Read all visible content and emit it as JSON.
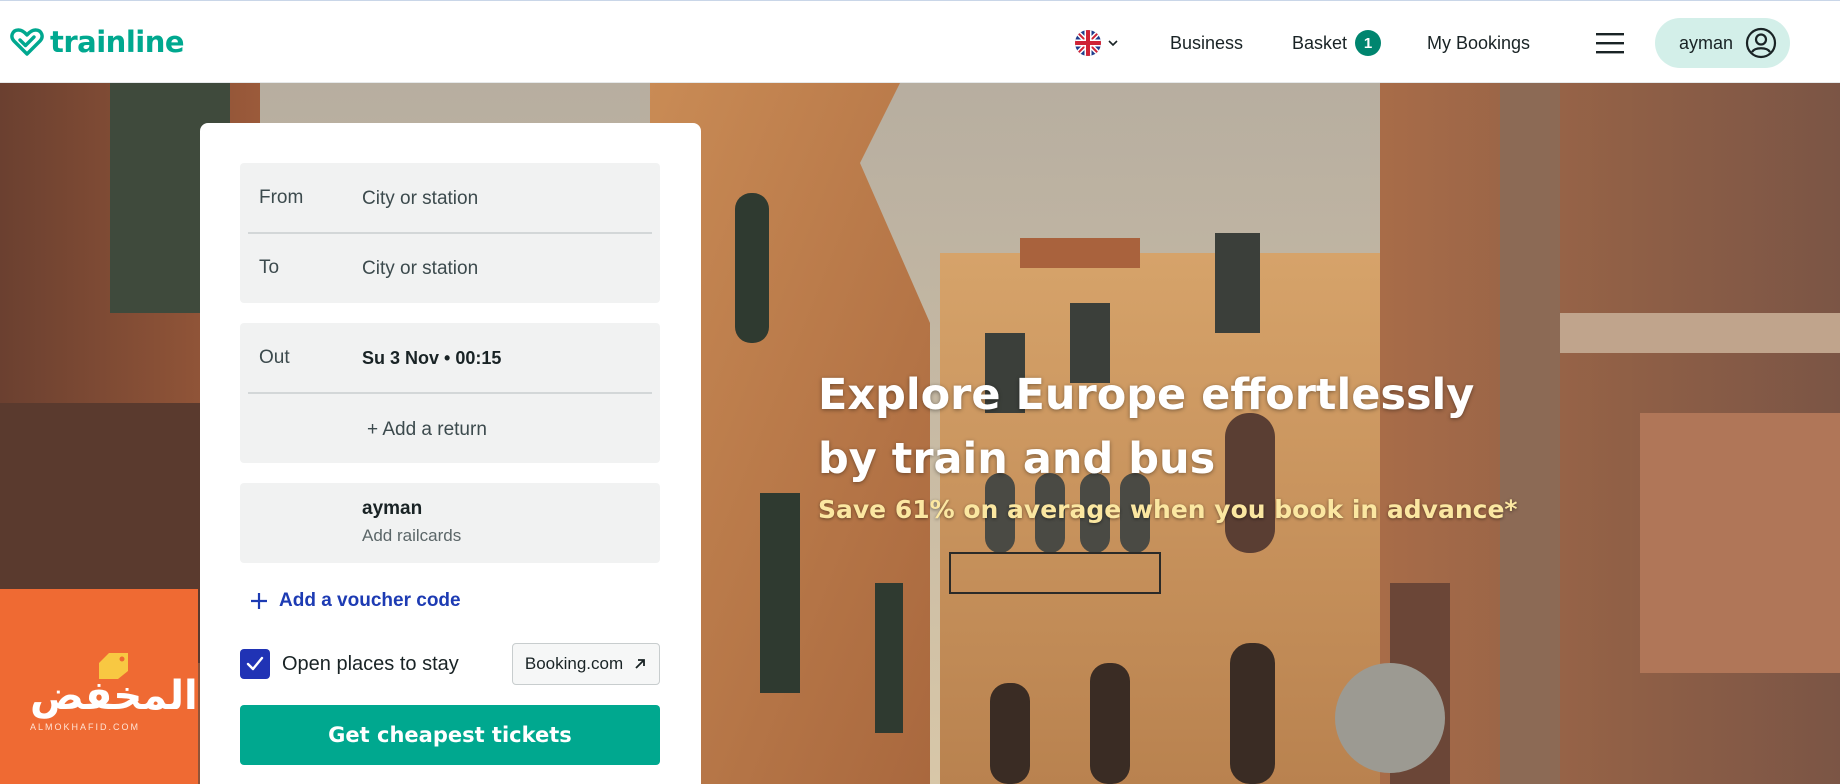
{
  "header": {
    "logo_text": "trainline",
    "language_flag": "uk-flag-icon",
    "business_label": "Business",
    "basket_label": "Basket",
    "basket_count": "1",
    "bookings_label": "My Bookings",
    "account_name": "ayman"
  },
  "hero": {
    "headline": "Explore Europe effortlessly by train and bus",
    "subline": "Save 61% on average when you book in advance*"
  },
  "search": {
    "from_label": "From",
    "from_placeholder": "City or station",
    "to_label": "To",
    "to_placeholder": "City or station",
    "out_label": "Out",
    "out_value": "Su 3 Nov • 00:15",
    "add_return": "+ Add a return",
    "passenger_name": "ayman",
    "railcards_label": "Add railcards",
    "voucher_label": "Add a voucher code",
    "stay_label": "Open places to stay",
    "stay_checked": true,
    "booking_link": "Booking.com",
    "cta_label": "Get cheapest tickets"
  },
  "promo": {
    "title": "المخفض",
    "subtitle": "ALMOKHAFID.COM"
  },
  "colors": {
    "brand": "#00a88f",
    "accent_blue": "#1d3bb3",
    "promo_orange": "#ef6a33",
    "account_bg": "#d3efe9"
  }
}
